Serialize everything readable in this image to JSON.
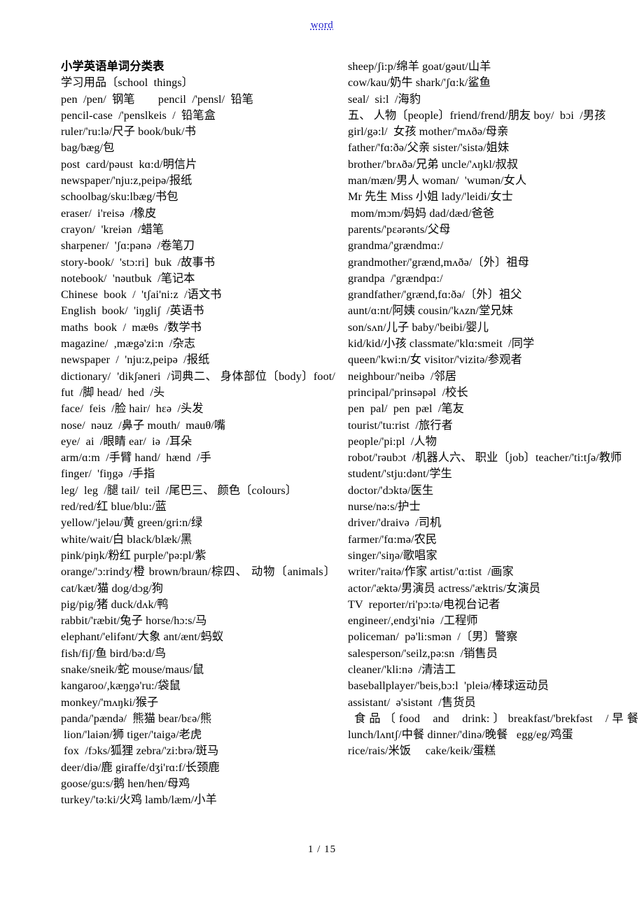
{
  "header": {
    "link_text": "word",
    "link_color": "#2222cc"
  },
  "document": {
    "title": "小学英语单词分类表"
  },
  "left_column": {
    "lines": [
      "学习用品〔school  things〕",
      "pen  /pen/  钢笔        pencil  /'pensl/  铅笔",
      "pencil-case  /'penslkeis  /  铅笔盒",
      "ruler/'ru:lə/尺子 book/buk/书",
      "bag/bæg/包",
      "post  card/pəust  kɑ:d/明信片",
      "newspaper/'nju:z,peipə/报纸",
      "schoolbag/sku:lbæg/书包",
      "eraser/  i'reisə  /橡皮",
      "crayon/  'kreiən  /蜡笔",
      "sharpener/  'ʃɑ:pənə  /卷笔刀",
      "story-book/  'stɔ:ri]  buk  /故事书",
      "notebook/  'nəutbuk  /笔记本",
      "Chinese  book  /  'tʃai'ni:z  /语文书",
      "English  book/  'iŋgliʃ  /英语书",
      "maths  book  /  mæθs  /数学书",
      "magazine/  ,mægə'zi:n  /杂志",
      "newspaper  /  'nju:z,peipə  /报纸",
      "dictionary/  'dikʃəneri  /词典二、 身体部位〔body〕foot/  fut  /脚 head/  hed  /头",
      "face/  feis  /脸 hair/  hɛə  /头发",
      "nose/  nəuz  /鼻子 mouth/  mauθ/嘴",
      "eye/  ai  /眼睛 ear/  iə  /耳朵",
      "arm/ɑ:m  /手臂 hand/  hænd  /手",
      "finger/  'fiŋgə  /手指",
      "leg/  leg  /腿 tail/  teil  /尾巴三、 颜色〔colours〕",
      "red/red/红 blue/blu:/蓝",
      "yellow/'jeləu/黄 green/gri:n/绿",
      "white/wait/白 black/blæk/黑",
      "pink/piŋk/粉红 purple/'pə:pl/紫",
      "orange/'ɔ:rindʒ/橙 brown/braun/棕四、 动物〔animals〕 cat/kæt/猫 dog/dɔg/狗",
      "pig/pig/猪 duck/dʌk/鸭",
      "rabbit/'ræbit/兔子 horse/hɔ:s/马",
      "elephant/'elifənt/大象 ant/ænt/蚂蚁",
      "fish/fiʃ/鱼 bird/bə:d/鸟",
      "snake/sneik/蛇 mouse/maus/鼠",
      "kangaroo/,kæŋgə'ru:/袋鼠",
      "monkey/'mʌŋki/猴子",
      "panda/'pændə/  熊猫 bear/bɛə/熊",
      " lion/'laiən/狮 tiger/'taigə/老虎",
      " fox  /fɔks/狐狸 zebra/'zi:brə/斑马",
      "deer/diə/鹿 giraffe/dʒi'rɑ:f/长颈鹿",
      "goose/gu:s/鹅 hen/hen/母鸡",
      "turkey/'tə:ki/火鸡 lamb/læm/小羊"
    ]
  },
  "right_column": {
    "lines": [
      "sheep/ʃi:p/绵羊 goat/gəut/山羊",
      "cow/kau/奶牛 shark/'ʃɑ:k/鲨鱼",
      "seal/  si:l  /海豹",
      "五、 人物〔people〕friend/frend/朋友 boy/  bɔi  /男孩",
      "girl/gə:l/  女孩 mother/'mʌðə/母亲",
      "father/'fɑ:ðə/父亲 sister/'sistə/姐妹",
      "brother/'brʌðə/兄弟 uncle/'ʌŋkl/叔叔",
      "man/mæn/男人 woman/  'wumən/女人",
      "Mr 先生 Miss 小姐 lady/'leidi/女士",
      " mom/mɔm/妈妈 dad/dæd/爸爸",
      "parents/'pɛərənts/父母",
      "grandma/'grændmɑ:/",
      "grandmother/'grænd,mʌðə/〔外〕祖母",
      "grandpa  /'grændpɑ:/",
      "grandfather/'grænd,fɑ:ðə/〔外〕祖父",
      "aunt/ɑ:nt/阿姨 cousin/'kʌzn/堂兄妹",
      "son/sʌn/儿子 baby/'beibi/婴儿",
      "kid/kid/小孩 classmate/'klɑ:smeit  /同学",
      "queen/'kwi:n/女 visitor/'vizitə/参观者",
      "neighbour/'neibə  /邻居",
      "principal/'prinsəpəl  /校长",
      "pen  pal/  pen  pæl  /笔友",
      "tourist/'tu:rist  /旅行者",
      "people/'pi:pl  /人物",
      "robot/'rəubɔt  /机器人六、 职业〔job〕teacher/'ti:tʃə/教师",
      "student/'stju:dənt/学生",
      "doctor/'dɔktə/医生",
      "nurse/nə:s/护士",
      "driver/'draivə  /司机",
      "farmer/'fɑ:mə/农民",
      "singer/'siŋə/歌唱家",
      "writer/'raitə/作家 artist/'ɑ:tist  /画家",
      "actor/'æktə/男演员 actress/'æktris/女演员",
      "TV  reporter/ri'pɔ:tə/电视台记者",
      "engineer/,endʒi'niə  /工程师",
      "policeman/  pə'li:smən  /〔男〕警察",
      "salesperson/'seilz,pə:sn  /销售员",
      "cleaner/'kli:nə  /清洁工",
      "baseballplayer/'beis,bɔ:l  'pleiə/棒球运动员",
      "assistant/  ə'sistənt  /售货员",
      " 食品〔food  and  drink:〕breakfast/'brekfəst  /早餐    lunch/lʌntʃ/中餐 dinner/'dinə/晚餐   egg/eg/鸡蛋",
      "rice/rais/米饭     cake/keik/蛋糕"
    ]
  },
  "footer": {
    "page_number": "1 / 15"
  }
}
